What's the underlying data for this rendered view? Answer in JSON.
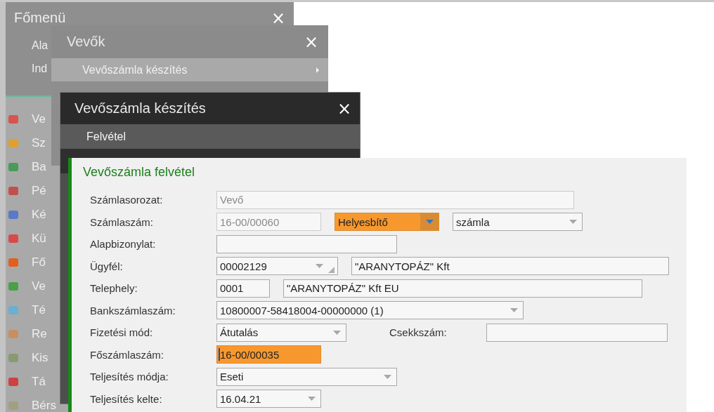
{
  "main_menu": {
    "title": "Főmenü",
    "close": "×",
    "items": [
      "Ala",
      "Ind"
    ],
    "modules": [
      "Ve",
      "Sz",
      "Ba",
      "Pé",
      "Ké",
      "Kü",
      "Fő",
      "Ve",
      "Té",
      "Re",
      "Kis",
      "Tá",
      "Bérs"
    ]
  },
  "customers_menu": {
    "title": "Vevők",
    "close": "×",
    "items": [
      {
        "label": "Vevőszámla készítés",
        "selected": true
      }
    ]
  },
  "invoice_menu": {
    "title": "Vevőszámla készítés",
    "close": "×",
    "items": [
      {
        "label": "Felvétel",
        "selected": true
      }
    ]
  },
  "form": {
    "title": "Vevőszámla felvétel",
    "rows": [
      {
        "label": "Számlasorozat:",
        "fields": [
          {
            "kind": "input",
            "value": "Vevő",
            "disabled": true,
            "highlighted": false,
            "focused": false
          }
        ]
      },
      {
        "label": "Számlaszám:",
        "fields": [
          {
            "kind": "input",
            "value": "16-00/00060",
            "disabled": true,
            "highlighted": false,
            "focused": false
          },
          {
            "kind": "select",
            "value": "Helyesbítő",
            "disabled": false,
            "highlighted": true,
            "focused": false
          },
          {
            "kind": "select",
            "value": "számla",
            "disabled": false,
            "highlighted": false,
            "focused": false
          }
        ]
      },
      {
        "label": "Alapbizonylat:",
        "fields": [
          {
            "kind": "input",
            "disabled": false,
            "highlighted": false,
            "focused": false
          }
        ]
      },
      {
        "label": "Ügyfél:",
        "fields": [
          {
            "kind": "combo",
            "value": "00002129",
            "disabled": false,
            "highlighted": false,
            "focused": false
          },
          {
            "kind": "input",
            "value": "\"ARANYTOPÁZ\" Kft",
            "disabled": false,
            "highlighted": false,
            "focused": false
          }
        ]
      },
      {
        "label": "Telephely:",
        "fields": [
          {
            "kind": "input",
            "value": "0001",
            "disabled": false,
            "highlighted": false,
            "focused": false
          },
          {
            "kind": "input",
            "value": "\"ARANYTOPÁZ\" Kft EU",
            "disabled": false,
            "highlighted": false,
            "focused": false
          }
        ]
      },
      {
        "label": "Bankszámlaszám:",
        "fields": [
          {
            "kind": "select",
            "value": "10800007-58418004-00000000 (1)",
            "disabled": false,
            "highlighted": false,
            "focused": false
          }
        ]
      },
      {
        "label": "Fizetési mód:",
        "fields": [
          {
            "kind": "select",
            "value": "Átutalás",
            "disabled": false,
            "highlighted": false,
            "focused": false
          },
          {
            "kind": "label",
            "value": "Csekkszám:"
          },
          {
            "kind": "input",
            "disabled": false,
            "highlighted": false,
            "focused": false
          }
        ]
      },
      {
        "label": "Főszámlaszám:",
        "fields": [
          {
            "kind": "input",
            "value": "16-00/00035",
            "disabled": false,
            "highlighted": true,
            "focused": true
          }
        ]
      },
      {
        "label": "Teljesítés módja:",
        "fields": [
          {
            "kind": "select",
            "value": "Eseti",
            "disabled": false,
            "highlighted": false,
            "focused": false
          }
        ]
      },
      {
        "label": "Teljesítés kelte:",
        "fields": [
          {
            "kind": "select",
            "value": "16.04.21",
            "disabled": false,
            "highlighted": false,
            "focused": false
          }
        ]
      }
    ]
  }
}
